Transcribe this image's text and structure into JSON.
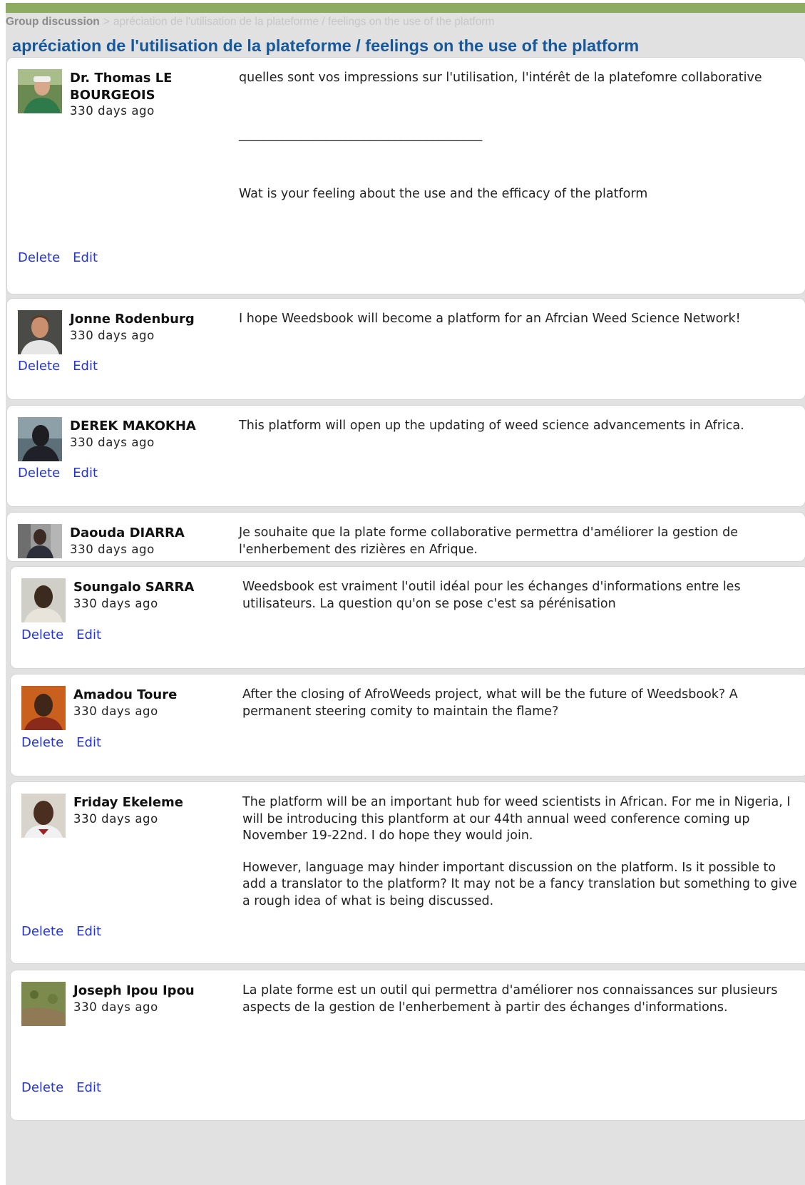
{
  "breadcrumb": {
    "root": "Group discussion",
    "separator": ">",
    "current": "apréciation de l'utilisation de la plateforme / feelings on the use of the platform"
  },
  "title": "apréciation de l'utilisation de la plateforme / feelings on the use of the platform",
  "colors": {
    "topbar": "#8eab62",
    "title": "#16589a",
    "link": "#2233dd",
    "background": "#e1e1e1"
  },
  "actions": {
    "delete": "Delete",
    "edit": "Edit"
  },
  "posts": [
    {
      "author_lines": [
        "Dr. Thomas LE",
        "BOURGEOIS"
      ],
      "time": "330 days ago",
      "paragraphs": [
        "quelles sont vos impressions  sur l'utilisation, l'intérêt de la platefomre collaborative"
      ],
      "divider": "_______________________________________",
      "paragraphs_after": [
        "Wat is your feeling about the use and the efficacy of the platform"
      ]
    },
    {
      "author_lines": [
        "Jonne Rodenburg"
      ],
      "time": "330 days ago",
      "paragraphs": [
        "I hope Weedsbook will become a platform for an Afrcian Weed Science Network!"
      ]
    },
    {
      "author_lines": [
        "DEREK MAKOKHA"
      ],
      "time": "330 days ago",
      "paragraphs": [
        "This platform will open up the updating of weed science advancements in Africa."
      ]
    },
    {
      "author_lines": [
        "Daouda DIARRA"
      ],
      "time": "330 days ago",
      "paragraphs": [
        "Je souhaite que la plate forme collaborative permettra d'améliorer la gestion de l'enherbement des rizières en Afrique."
      ]
    },
    {
      "author_lines": [
        "Soungalo SARRA"
      ],
      "time": "330 days ago",
      "paragraphs": [
        "Weedsbook est vraiment l'outil idéal pour les échanges d'informations entre les utilisateurs. La question qu'on se pose c'est sa pérénisation"
      ]
    },
    {
      "author_lines": [
        "Amadou Toure"
      ],
      "time": "330 days ago",
      "paragraphs": [
        "After the closing of AfroWeeds project, what will be the future of Weedsbook? A permanent steering comity to maintain the flame?"
      ]
    },
    {
      "author_lines": [
        "Friday Ekeleme"
      ],
      "time": "330 days ago",
      "paragraphs": [
        "The platform will be an important hub for weed scientists in African. For me in Nigeria, I will be introducing this plantform at our 44th annual weed conference coming up November 19-22nd. I do hope they would join.",
        "However, language may hinder  important discussion on the platform. Is it possible to add a translator to the platform? It may not be a fancy translation but something to give a rough idea of what is being discussed."
      ]
    },
    {
      "author_lines": [
        "Joseph Ipou Ipou"
      ],
      "time": "330 days ago",
      "paragraphs": [
        "La plate forme est un outil qui permettra d'améliorer nos connaissances sur plusieurs aspects de la gestion de l'enherbement à partir des échanges d'informations."
      ]
    }
  ]
}
